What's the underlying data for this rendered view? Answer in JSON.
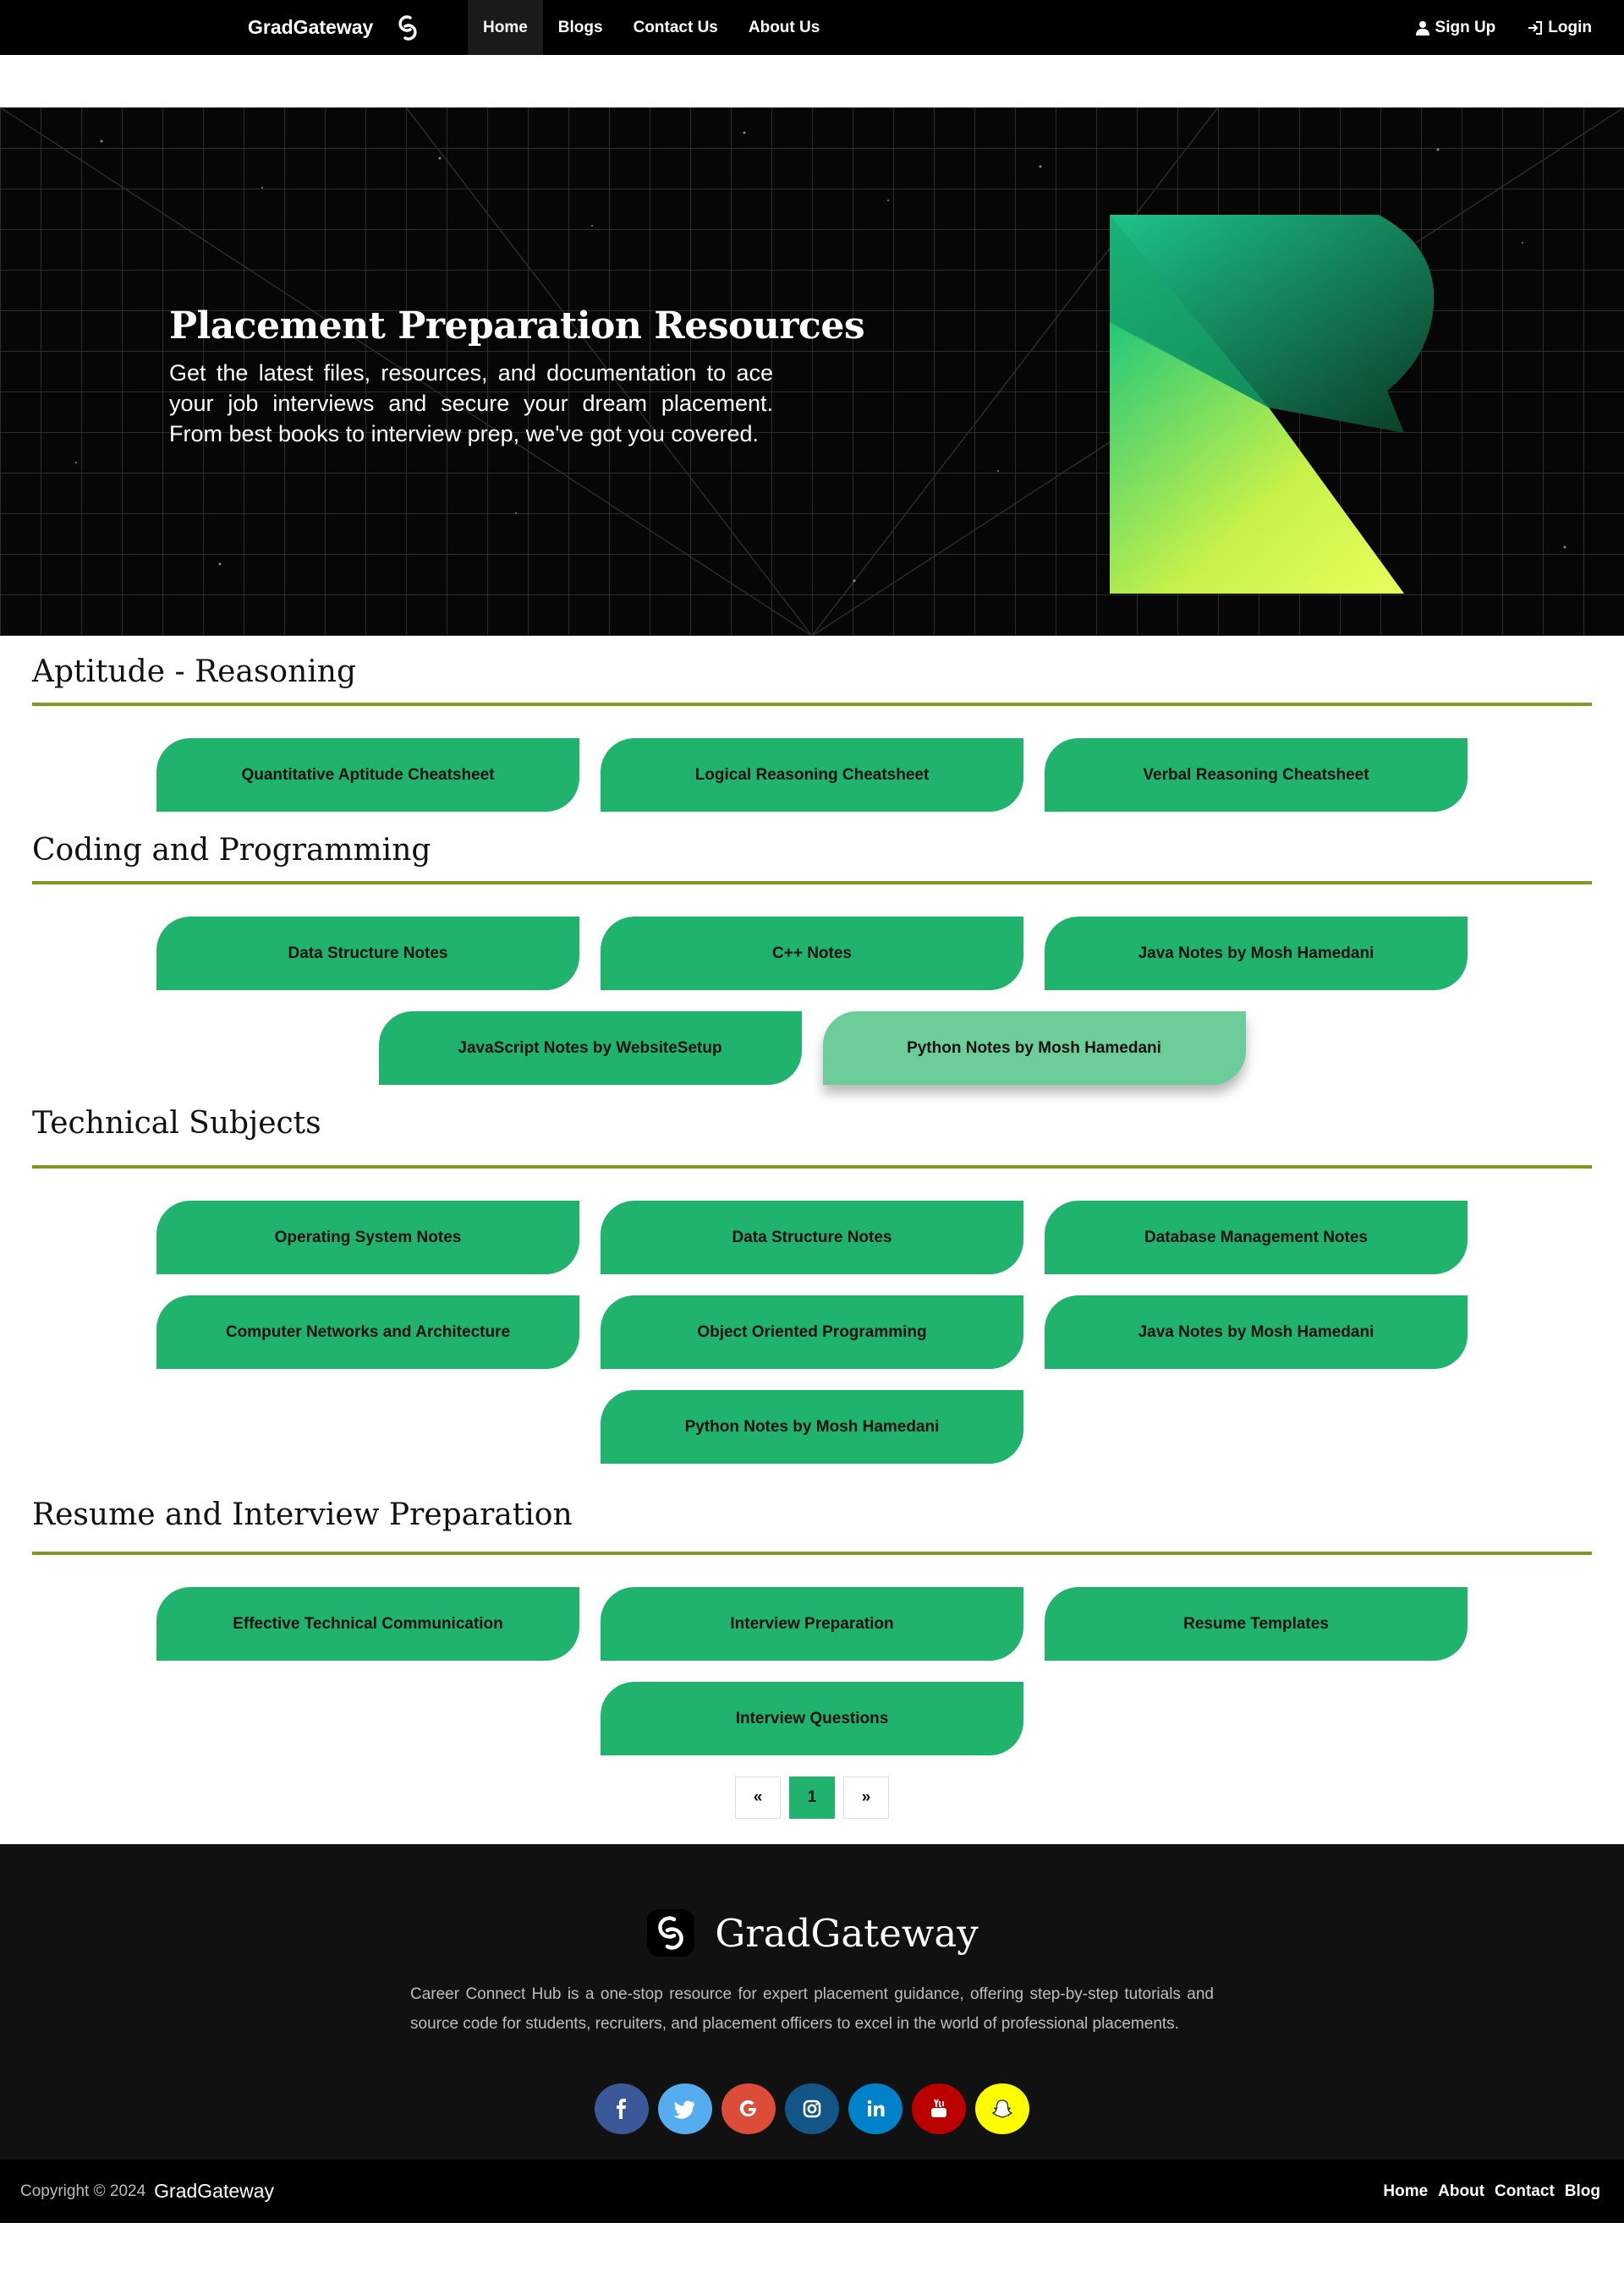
{
  "nav": {
    "brand": "GradGateway",
    "links": [
      "Home",
      "Blogs",
      "Contact Us",
      "About Us"
    ],
    "signup": "Sign Up",
    "login": "Login"
  },
  "hero": {
    "title": "Placement Preparation Resources",
    "subtitle": "Get the latest files, resources, and documentation to ace your job interviews and secure your dream placement. From best books to interview prep, we've got you covered."
  },
  "sections": [
    {
      "title": "Aptitude - Reasoning",
      "rows": [
        [
          "Quantitative Aptitude Cheatsheet",
          "Logical Reasoning Cheatsheet",
          "Verbal Reasoning Cheatsheet"
        ]
      ]
    },
    {
      "title": "Coding and Programming",
      "rows": [
        [
          "Data Structure Notes",
          "C++ Notes",
          "Java Notes by Mosh Hamedani"
        ],
        [
          "JavaScript Notes by WebsiteSetup",
          "Python Notes by Mosh Hamedani"
        ]
      ]
    },
    {
      "title": "Technical Subjects",
      "rows": [
        [
          "Operating System Notes",
          "Data Structure Notes",
          "Database Management Notes"
        ],
        [
          "Computer Networks and Architecture",
          "Object Oriented Programming",
          "Java Notes by Mosh Hamedani"
        ],
        [
          "Python Notes by Mosh Hamedani"
        ]
      ]
    },
    {
      "title": "Resume and Interview Preparation",
      "rows": [
        [
          "Effective Technical Communication",
          "Interview Preparation",
          "Resume Templates"
        ],
        [
          "Interview Questions"
        ]
      ]
    }
  ],
  "pagination": {
    "prev": "«",
    "current": "1",
    "next": "»"
  },
  "footer": {
    "brand": "GradGateway",
    "description": "Career Connect Hub is a one-stop resource for expert placement guidance, offering step-by-step tutorials and source code for students, recruiters, and placement officers to excel in the world of professional placements.",
    "socials": [
      {
        "name": "facebook-icon",
        "color": "#3b5998"
      },
      {
        "name": "twitter-icon",
        "color": "#55acee"
      },
      {
        "name": "google-icon",
        "color": "#dd4b39"
      },
      {
        "name": "instagram-icon",
        "color": "#125688"
      },
      {
        "name": "linkedin-icon",
        "color": "#0082ca"
      },
      {
        "name": "youtube-icon",
        "color": "#bb0000"
      },
      {
        "name": "snapchat-icon",
        "color": "#fffc00"
      }
    ],
    "copyright_prefix": "Copyright © 2024",
    "copyright_brand": "GradGateway",
    "bottom_links": [
      "Home",
      "About",
      "Contact",
      "Blog"
    ]
  },
  "colors": {
    "accent_green": "#1fb36e",
    "rule_olive": "#7f9a23"
  }
}
